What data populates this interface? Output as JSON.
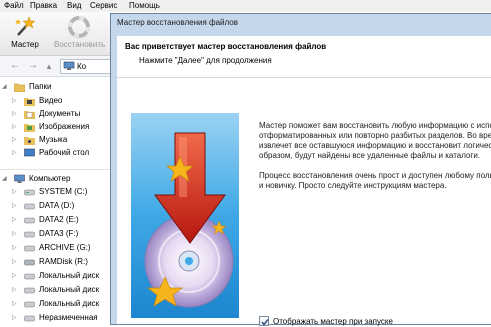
{
  "menu": [
    "Файл",
    "Правка",
    "Вид",
    "Сервис",
    "Помощь"
  ],
  "toolbar": {
    "wizard_label": "Мастер",
    "restore_label": "Восстановить"
  },
  "address": {
    "text": "Ко"
  },
  "tree": {
    "folders_label": "Папки",
    "folders": [
      "Видео",
      "Документы",
      "Изображения",
      "Музыка",
      "Рабочий стол"
    ],
    "computer_label": "Компьютер",
    "drives": [
      "SYSTEM (C:)",
      "DATA (D:)",
      "DATA2 (E:)",
      "DATA3 (F:)",
      "ARCHIVE (G:)",
      "RAMDisk (R:)",
      "Локальный диск",
      "Локальный диск",
      "Локальный диск",
      "Неразмеченная"
    ]
  },
  "dialog": {
    "title": "Мастер восстановления файлов",
    "header_title": "Вас приветствует мастер восстановления файлов",
    "header_subtitle": "Нажмите \"Далее\" для продолжения",
    "para1": [
      "Мастер поможет вам восстановить любую информацию с испорчен",
      "отформатированных или повторно разбитых разделов. Во время ан",
      "извлечет все оставшуюся информацию и восстановит логическую с",
      "образом, будут найдены все удаленные файлы и каталоги."
    ],
    "para2": [
      "Процесс восстановления очень прост и доступен любому пользоват",
      "и новичку. Просто следуйте инструкциям мастера."
    ],
    "checkbox_label": "Отображать мастер при запуске",
    "checkbox_checked": true
  },
  "colors": {
    "dialog_frame": "#c5d7ea",
    "image_blue": "#3ea8e6",
    "arrow_red": "#d8261c",
    "star": "#f6b51c"
  }
}
